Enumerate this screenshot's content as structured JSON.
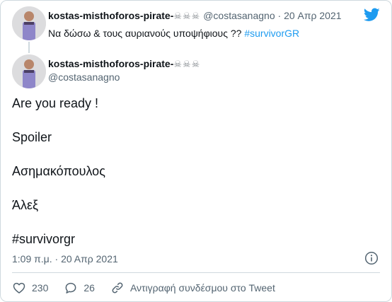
{
  "parent_tweet": {
    "author_name": "kostas-misthoforos-pirate-",
    "author_emoji": "☠☠☠",
    "handle": "@costasanagno",
    "separator": "·",
    "date": "20 Απρ 2021",
    "text": "Να δώσω & τους αυριανούς υποψήφιους ?? ",
    "hashtag": "#survivorGR"
  },
  "tweet": {
    "author_name": "kostas-misthoforos-pirate-",
    "author_emoji": "☠☠☠",
    "handle": "@costasanagno",
    "lines": [
      "Are you ready !",
      "Spoiler",
      "Ασημακόπουλος",
      "Άλεξ"
    ],
    "hashtag": "#survivorgr",
    "timestamp": "1:09 π.μ. · 20 Απρ 2021"
  },
  "actions": {
    "likes": "230",
    "replies": "26",
    "copy_link_label": "Αντιγραφή συνδέσμου στο Tweet"
  },
  "colors": {
    "link": "#1d9bf0",
    "secondary_text": "#536471",
    "border": "#cfd9de",
    "twitter_blue": "#1d9bf0"
  },
  "icons": {
    "brand": "twitter-bird-icon",
    "info": "info-icon",
    "like": "heart-icon",
    "reply": "reply-bubble-icon",
    "copy_link": "link-icon"
  }
}
